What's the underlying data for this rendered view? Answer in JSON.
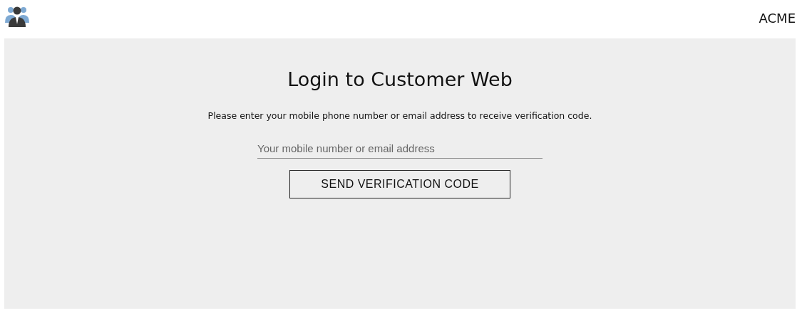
{
  "header": {
    "brand": "ACME"
  },
  "login": {
    "title": "Login to Customer Web",
    "instructions": "Please enter your mobile phone number or email address to receive verification code.",
    "field": {
      "placeholder": "Your mobile number or email address"
    },
    "button": "SEND VERIFICATION CODE"
  }
}
